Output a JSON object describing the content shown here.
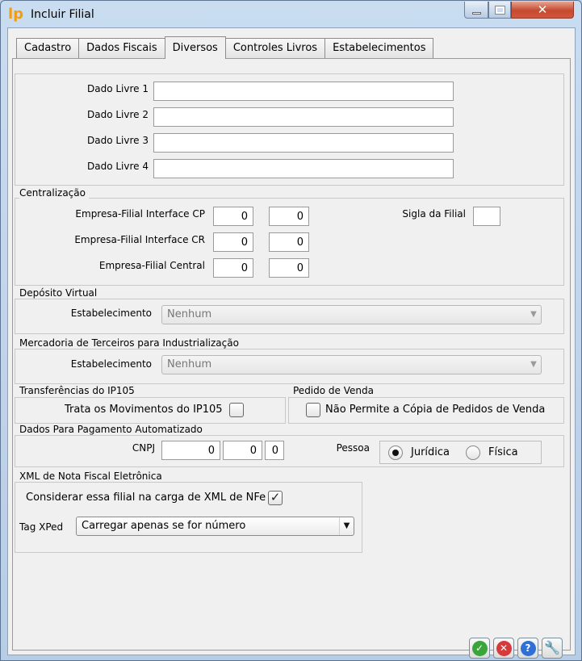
{
  "window": {
    "title": "Incluir Filial",
    "app_icon_glyph": "lp"
  },
  "tabs": [
    {
      "label": "Cadastro"
    },
    {
      "label": "Dados Fiscais"
    },
    {
      "label": "Diversos",
      "active": true
    },
    {
      "label": "Controles Livros"
    },
    {
      "label": "Estabelecimentos"
    }
  ],
  "dados_livres": {
    "labels": [
      "Dado Livre 1",
      "Dado Livre 2",
      "Dado Livre 3",
      "Dado Livre 4"
    ],
    "values": [
      "",
      "",
      "",
      ""
    ]
  },
  "centralizacao": {
    "legend": "Centralização",
    "cp_label": "Empresa-Filial Interface CP",
    "cp_1": "0",
    "cp_2": "0",
    "cr_label": "Empresa-Filial Interface CR",
    "cr_1": "0",
    "cr_2": "0",
    "central_label": "Empresa-Filial Central",
    "central_1": "0",
    "central_2": "0",
    "sigla_label": "Sigla da Filial",
    "sigla_value": ""
  },
  "deposito_virtual": {
    "legend": "Depósito Virtual",
    "label": "Estabelecimento",
    "value": "Nenhum"
  },
  "mercadoria_terceiros": {
    "legend": "Mercadoria de Terceiros para Industrialização",
    "label": "Estabelecimento",
    "value": "Nenhum"
  },
  "transferencias": {
    "legend": "Transferências do IP105",
    "label": "Trata os Movimentos do IP105",
    "checked": false
  },
  "pedido_venda": {
    "legend": "Pedido de Venda",
    "label": "Não Permite a Cópia de Pedidos de Venda",
    "checked": false
  },
  "pagamento": {
    "legend": "Dados Para Pagamento Automatizado",
    "cnpj_label": "CNPJ",
    "cnpj_1": "0",
    "cnpj_2": "0",
    "cnpj_3": "0",
    "pessoa_label": "Pessoa",
    "juridica_label": "Jurídica",
    "fisica_label": "Física",
    "selected": "Jurídica"
  },
  "xml_nfe": {
    "legend": "XML de Nota Fiscal Eletrônica",
    "considerar_label": "Considerar essa filial na carga de XML de NFe",
    "considerar_checked": true,
    "check_glyph": "✓",
    "tag_label": "Tag XPed",
    "tag_value": "Carregar apenas se for número"
  },
  "actions": {
    "ok_glyph": "✓",
    "cancel_glyph": "✕",
    "help_glyph": "?",
    "tools_glyph": "🔧"
  },
  "colors": {
    "ok": "#3aa53a",
    "cancel": "#d63b3b",
    "help": "#2f6fd6",
    "tools": "#e08a1a"
  }
}
